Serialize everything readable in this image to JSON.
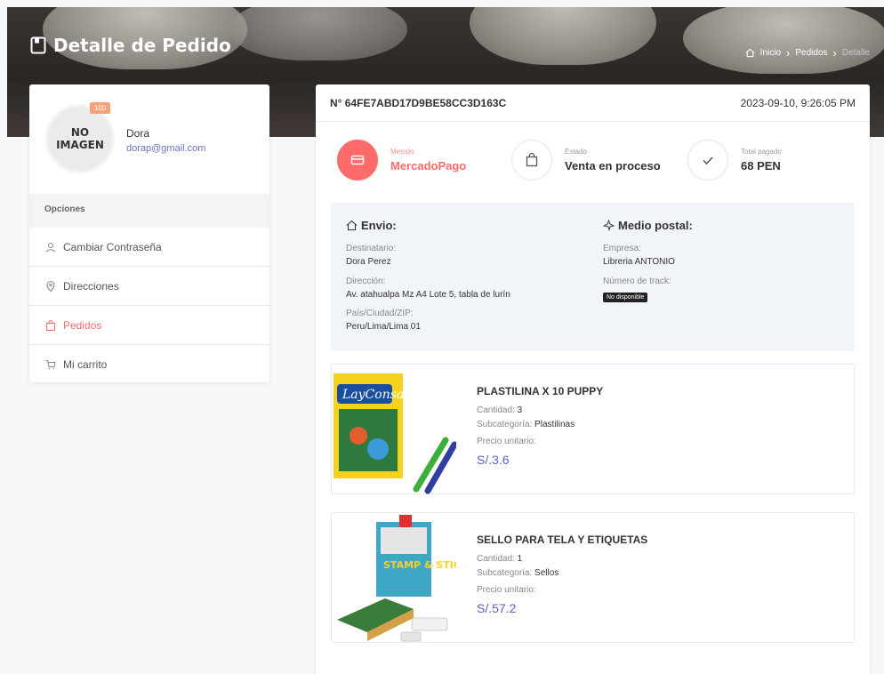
{
  "header": {
    "title": "Detalle de Pedido",
    "breadcrumb": {
      "home": "Inicio",
      "orders": "Pedidos",
      "current": "Detalle"
    }
  },
  "profile": {
    "avatar_text_1": "NO",
    "avatar_text_2": "IMAGEN",
    "badge": "100",
    "name": "Dora",
    "email": "dorap@gmail.com"
  },
  "options": {
    "heading": "Opciones",
    "items": [
      {
        "label": "Cambiar Contraseña",
        "icon": "user-icon"
      },
      {
        "label": "Direcciones",
        "icon": "location-icon"
      },
      {
        "label": "Pedidos",
        "icon": "bag-icon",
        "active": true
      },
      {
        "label": "Mi carrito",
        "icon": "cart-icon"
      }
    ]
  },
  "order": {
    "id": "N° 64FE7ABD17D9BE58CC3D163C",
    "date": "2023-09-10, 9:26:05 PM",
    "method_label": "Metodo",
    "method_value": "MercadoPago",
    "status_label": "Estado",
    "status_value": "Venta en proceso",
    "total_label": "Total pagado",
    "total_value": "68 PEN"
  },
  "shipping": {
    "envio_title": "Envio:",
    "recipient_label": "Destinatario:",
    "recipient_value": "Dora Perez",
    "address_label": "Dirección:",
    "address_value": "Av. atahualpa Mz A4 Lote 5, tabla de lurín",
    "country_label": "País/Ciudad/ZIP:",
    "country_value": "Peru/Lima/Lima 01",
    "postal_title": "Medio postal:",
    "company_label": "Empresa:",
    "company_value": "Libreria ANTONIO",
    "track_label": "Número de track:",
    "track_value": "No disponible"
  },
  "products": [
    {
      "name": "PLASTILINA X 10 PUPPY",
      "qty_label": "Cantidad:",
      "qty": "3",
      "subcat_label": "Subcategoría:",
      "subcat": "Plastilinas",
      "price_label": "Precio unitario:",
      "price": "S/.3.6",
      "brand": "LayConsa"
    },
    {
      "name": "SELLO PARA TELA Y ETIQUETAS",
      "qty_label": "Cantidad:",
      "qty": "1",
      "subcat_label": "Subcategoría:",
      "subcat": "Sellos",
      "price_label": "Precio unitario:",
      "price": "S/.57.2",
      "brand": "STAMP & STICK"
    }
  ],
  "colors": {
    "accent": "#ff6b6b",
    "link": "#5b63c8",
    "badge": "#f5a27a"
  }
}
